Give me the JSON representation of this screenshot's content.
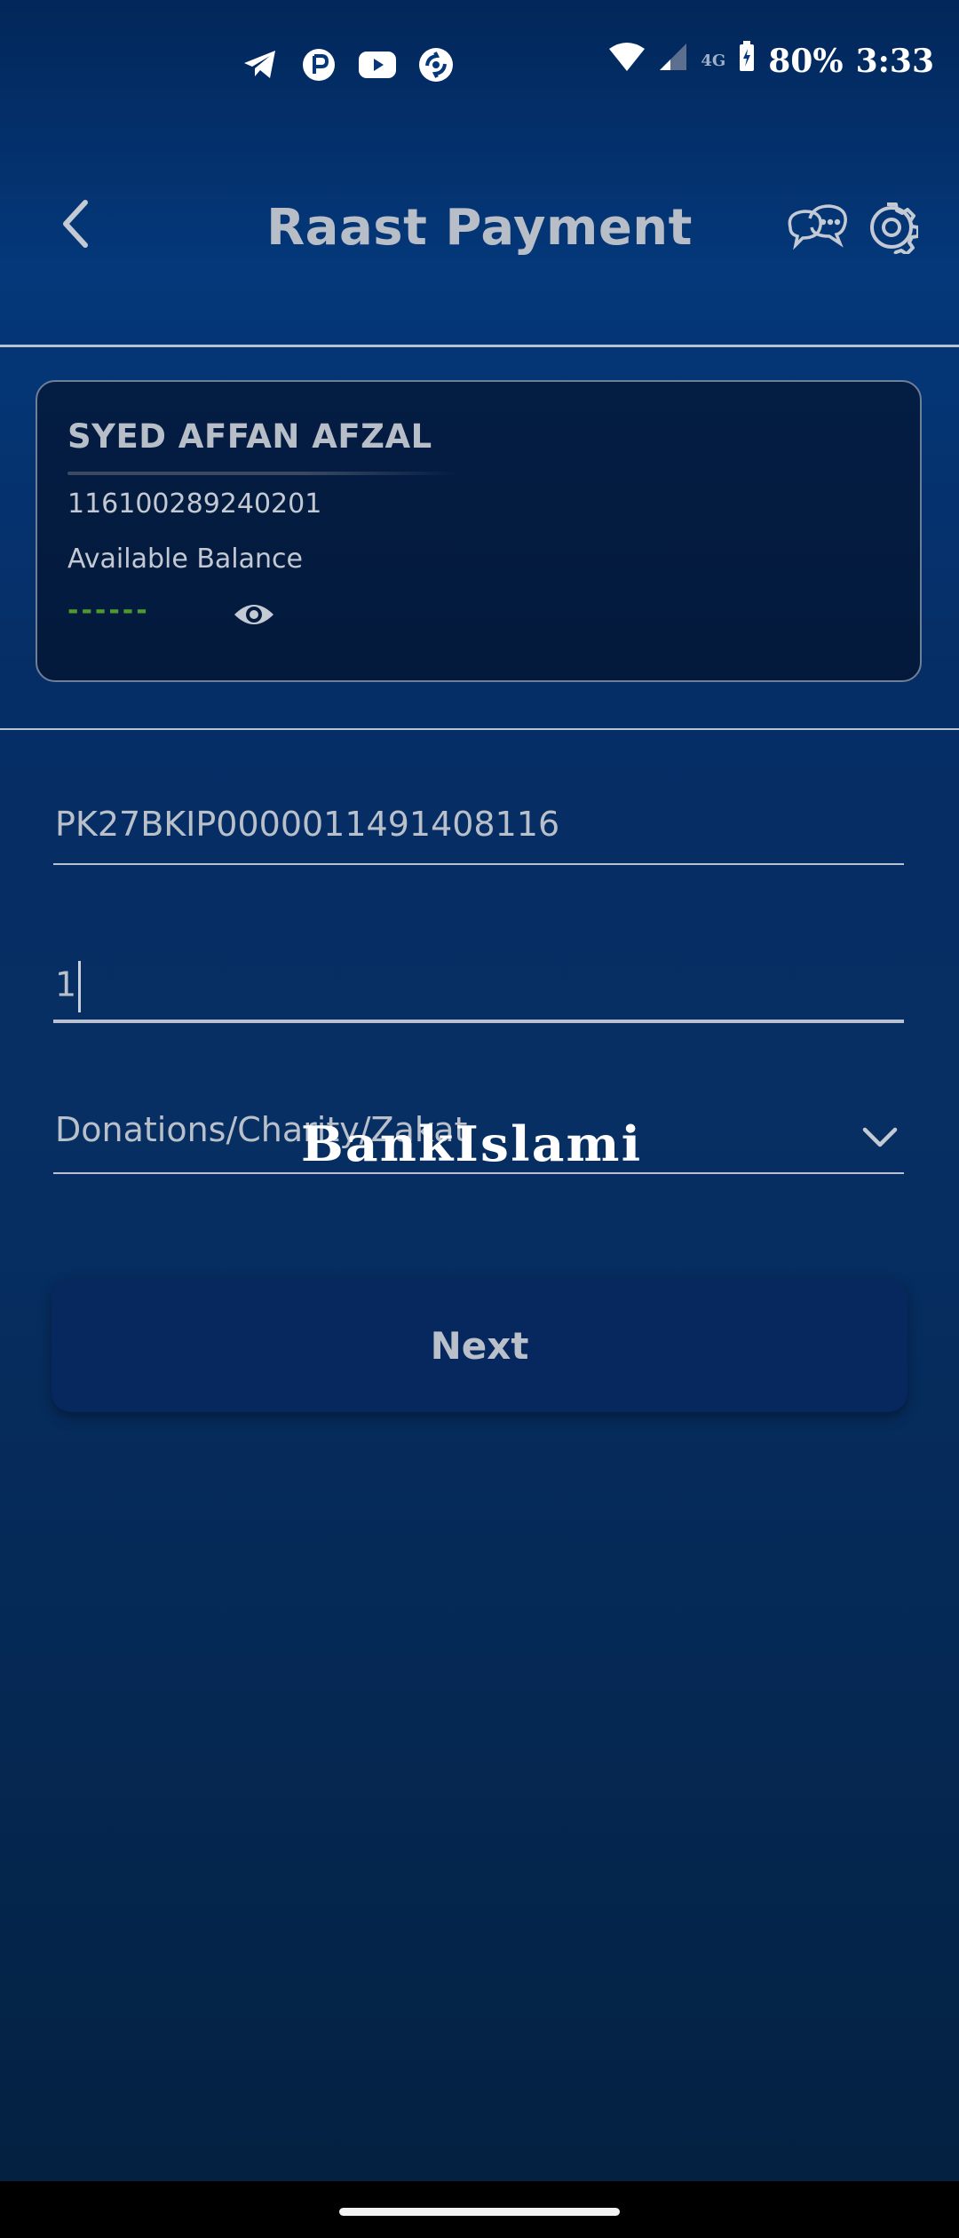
{
  "status_bar": {
    "app_icons": [
      "telegram-icon",
      "app-p-icon",
      "youtube-icon",
      "sync-app-icon"
    ],
    "network_label": "4G",
    "battery": "80%",
    "time": "3:33"
  },
  "header": {
    "title": "Raast Payment",
    "back_icon": "chevron-left-icon",
    "chat_icon": "chat-bubbles-icon",
    "settings_icon": "gear-icon"
  },
  "account": {
    "name": "SYED AFFAN AFZAL",
    "number": "116100289240201",
    "balance_label": "Available Balance",
    "balance_masked": "------",
    "visibility_icon": "eye-icon"
  },
  "form": {
    "iban_value": "PK27BKIP0000011491408116",
    "amount_value": "1",
    "purpose_value": "Donations/Charity/Zakat",
    "purpose_icon": "chevron-down-icon"
  },
  "watermark": "BankIslami",
  "next_label": "Next",
  "colors": {
    "background_top": "#04387a",
    "background_bottom": "#04203f",
    "card_bg": "#031a3c",
    "button_bg": "#06285e",
    "masked_balance": "#4e9a2e",
    "text": "#b9c0ca"
  }
}
